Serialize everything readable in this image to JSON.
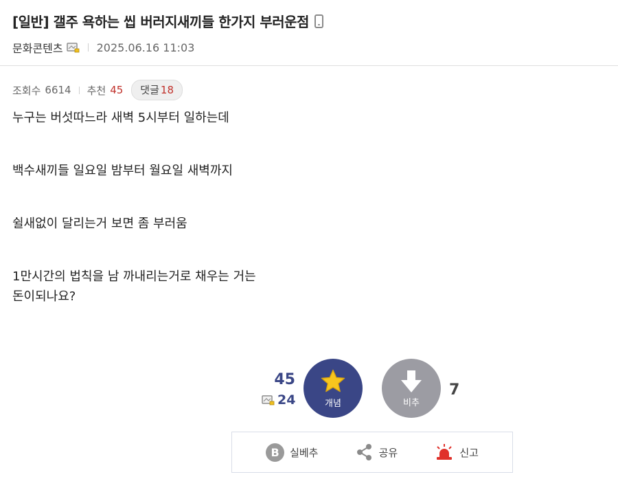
{
  "post": {
    "title": "[일반] 갤주 욕하는 씹 버러지새끼들 한가지 부러운점",
    "author": "문화콘텐츠",
    "date": "2025.06.16 11:03",
    "views_label": "조회수",
    "views": "6614",
    "recommend_label": "추천",
    "recommend": "45",
    "comments_label": "댓글",
    "comments": "18",
    "body": [
      "누구는 버섯따느라 새벽 5시부터 일하는데",
      "백수새끼들 일요일 밤부터 월요일 새벽까지",
      "쉴새없이 달리는거 보면 좀 부러움",
      "1만시간의 법칙을 남 까내리는거로 채우는 거는",
      "돈이되나요?"
    ]
  },
  "vote": {
    "up_count": "45",
    "fixed_count": "24",
    "up_label": "개념",
    "down_label": "비추",
    "down_count": "7"
  },
  "actions": {
    "best_label": "실베추",
    "share_label": "공유",
    "report_label": "신고"
  },
  "colors": {
    "accent_navy": "#3a4686",
    "down_gray": "#9c9ca3",
    "highlight_red": "#c0302a",
    "star_yellow": "#f7c51e",
    "siren_red": "#e0302a"
  },
  "icons": [
    "mobile-icon",
    "user-badge-icon",
    "star-icon",
    "down-arrow-icon",
    "b-icon",
    "share-icon",
    "siren-icon"
  ]
}
